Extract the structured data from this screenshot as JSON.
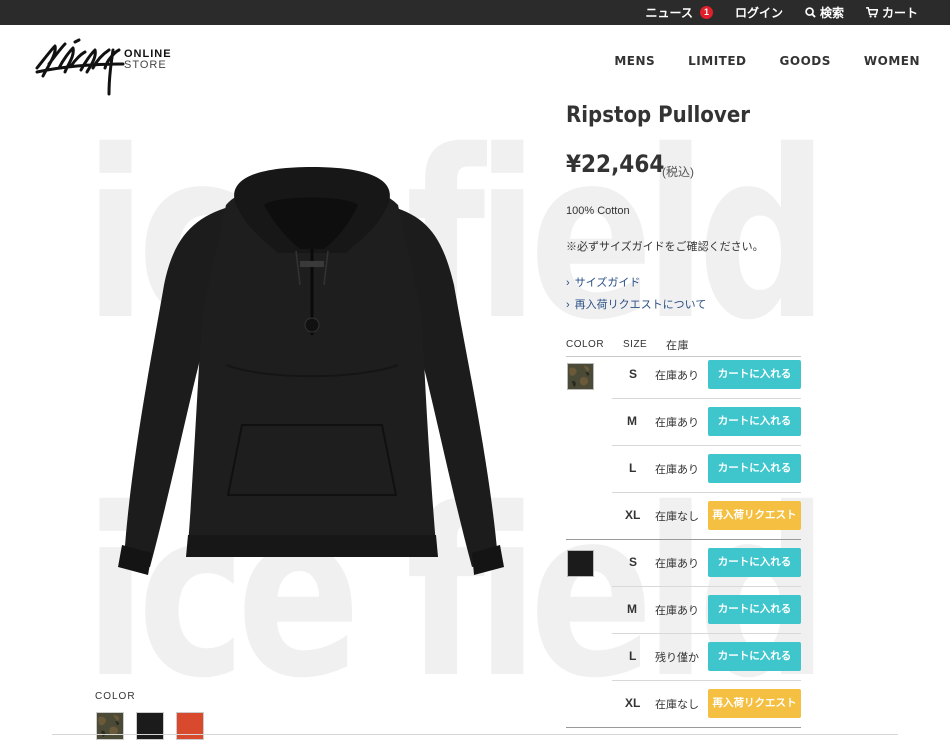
{
  "topbar": {
    "news_label": "ニュース",
    "news_badge": "1",
    "login_label": "ログイン",
    "search_label": "検索",
    "cart_label": "カート"
  },
  "header": {
    "logo_line1": "ONLINE",
    "logo_line2": "STORE",
    "nav": [
      "MENS",
      "LIMITED",
      "GOODS",
      "WOMEN"
    ]
  },
  "watermark": {
    "text": "ice field"
  },
  "product": {
    "title": "Ripstop Pullover",
    "price": "¥22,464",
    "tax_note": "(税込)",
    "material": "100% Cotton",
    "size_note": "※必ずサイズガイドをご確認ください。",
    "links": [
      "サイズガイド",
      "再入荷リクエストについて"
    ]
  },
  "gallery": {
    "color_label": "COLOR",
    "chips": [
      {
        "name": "camo",
        "color": "#4a4a36"
      },
      {
        "name": "black",
        "color": "#1b1b1b"
      },
      {
        "name": "orange",
        "color": "#d8492e"
      }
    ]
  },
  "stock_table": {
    "headers": {
      "color": "COLOR",
      "size": "SIZE",
      "stock": "在庫"
    },
    "groups": [
      {
        "color_name": "camo",
        "rows": [
          {
            "size": "S",
            "stock": "在庫あり",
            "button": "カートに入れる",
            "type": "cart"
          },
          {
            "size": "M",
            "stock": "在庫あり",
            "button": "カートに入れる",
            "type": "cart"
          },
          {
            "size": "L",
            "stock": "在庫あり",
            "button": "カートに入れる",
            "type": "cart"
          },
          {
            "size": "XL",
            "stock": "在庫なし",
            "button": "再入荷リクエスト",
            "type": "request"
          }
        ]
      },
      {
        "color_name": "black",
        "rows": [
          {
            "size": "S",
            "stock": "在庫あり",
            "button": "カートに入れる",
            "type": "cart"
          },
          {
            "size": "M",
            "stock": "在庫あり",
            "button": "カートに入れる",
            "type": "cart"
          },
          {
            "size": "L",
            "stock": "残り僅か",
            "button": "カートに入れる",
            "type": "cart"
          },
          {
            "size": "XL",
            "stock": "在庫なし",
            "button": "再入荷リクエスト",
            "type": "request"
          }
        ]
      }
    ]
  },
  "colors": {
    "topbar_bg": "#2b2b2b",
    "cart_button": "#3ec6cc",
    "request_button": "#f5c042",
    "link": "#2a4f86",
    "badge": "#e0202b"
  }
}
